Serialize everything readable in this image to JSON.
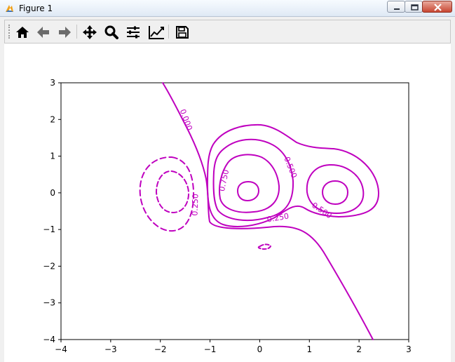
{
  "window": {
    "title": "Figure 1",
    "app_icon": "matplotlib-icon",
    "buttons": [
      "minimize-icon",
      "restore-icon",
      "close-icon"
    ]
  },
  "toolbar": {
    "items": [
      {
        "name": "home-button",
        "icon": "home-icon"
      },
      {
        "name": "back-button",
        "icon": "arrow-left-icon"
      },
      {
        "name": "forward-button",
        "icon": "arrow-right-icon"
      },
      {
        "name": "pan-button",
        "icon": "move-icon"
      },
      {
        "name": "zoom-button",
        "icon": "zoom-icon"
      },
      {
        "name": "subplots-button",
        "icon": "sliders-icon"
      },
      {
        "name": "edit-axis-button",
        "icon": "chart-line-icon"
      },
      {
        "name": "save-button",
        "icon": "save-icon"
      }
    ]
  },
  "chart_data": {
    "type": "contour",
    "xlim": [
      -4,
      3
    ],
    "ylim": [
      -4,
      3
    ],
    "x_ticks": [
      -4,
      -3,
      -2,
      -1,
      0,
      1,
      2,
      3
    ],
    "y_ticks": [
      -4,
      -3,
      -2,
      -1,
      0,
      1,
      2,
      3
    ],
    "line_color": "#bf00bf",
    "contour_labels": [
      "0.000",
      "0.750",
      "0.500",
      "0.250",
      "0.250",
      "0.500"
    ],
    "negative_contours": "dashed",
    "grid": false
  }
}
